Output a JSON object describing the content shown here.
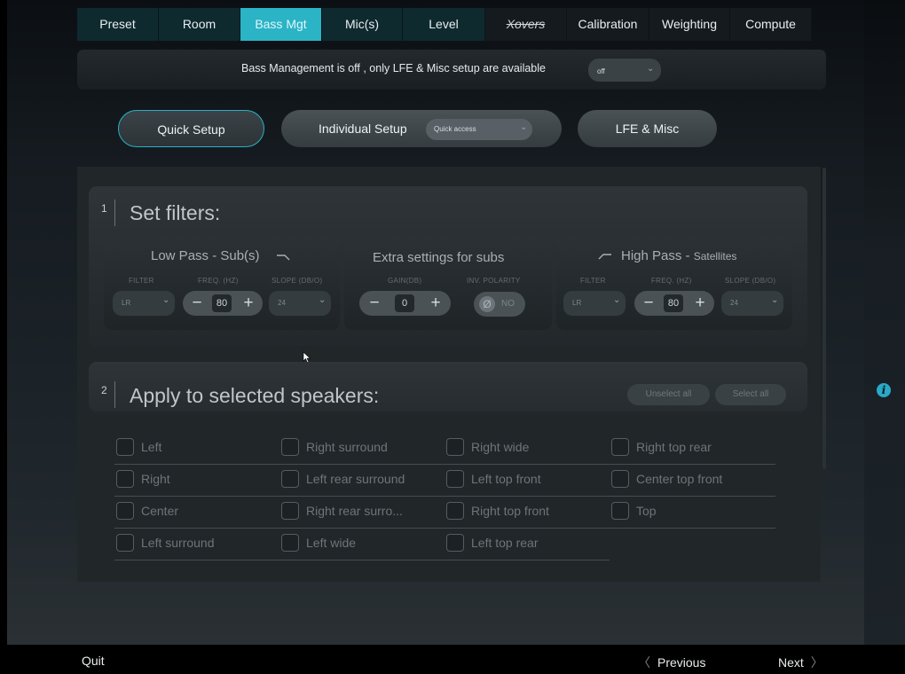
{
  "tabs": [
    {
      "label": "Preset"
    },
    {
      "label": "Room"
    },
    {
      "label": "Bass Mgt"
    },
    {
      "label": "Mic(s)"
    },
    {
      "label": "Level"
    },
    {
      "label": "Xovers"
    },
    {
      "label": "Calibration"
    },
    {
      "label": "Weighting"
    },
    {
      "label": "Compute"
    }
  ],
  "banner": {
    "message": "Bass Management is off , only LFE & Misc setup are available",
    "select_value": "off"
  },
  "modes": {
    "quick_setup": "Quick Setup",
    "individual_setup": "Individual Setup",
    "individual_select_placeholder": "Quick access",
    "lfe_misc": "LFE & Misc"
  },
  "section1": {
    "number": "1",
    "title": "Set filters:",
    "low_pass": {
      "title": "Low Pass - Sub(s)",
      "filter_label": "FILTER",
      "filter_value": "LR",
      "freq_label": "FREQ. (hz)",
      "freq_value": "80",
      "slope_label": "SLOPE (dB/o)",
      "slope_value": "24"
    },
    "extra": {
      "title": "Extra settings for subs",
      "gain_label": "GAIN(dB)",
      "gain_value": "0",
      "polarity_label": "INV. POLARITY",
      "polarity_symbol": "Ø",
      "polarity_value": "NO"
    },
    "high_pass": {
      "title": "High Pass - ",
      "title_suffix": "Satellites",
      "filter_label": "FILTER",
      "filter_value": "LR",
      "freq_label": "FREQ. (hz)",
      "freq_value": "80",
      "slope_label": "SLOPE (dB/o)",
      "slope_value": "24"
    }
  },
  "section2": {
    "number": "2",
    "title": "Apply to selected speakers:",
    "unselect_all": "Unselect all",
    "select_all": "Select all",
    "speakers": [
      [
        "Left",
        "Right",
        "Center",
        "Left surround"
      ],
      [
        "Right surround",
        "Left rear surround",
        "Right rear surro...",
        "Left wide"
      ],
      [
        "Right wide",
        "Left top front",
        "Right top front",
        "Left top rear"
      ],
      [
        "Right top rear",
        "Center top front",
        "Top"
      ]
    ]
  },
  "footer": {
    "quit": "Quit",
    "previous": "Previous",
    "next": "Next"
  },
  "colors": {
    "accent": "#2bb3c6",
    "tab_bg": "#0e2a2f",
    "panel_bg": "#212629"
  }
}
